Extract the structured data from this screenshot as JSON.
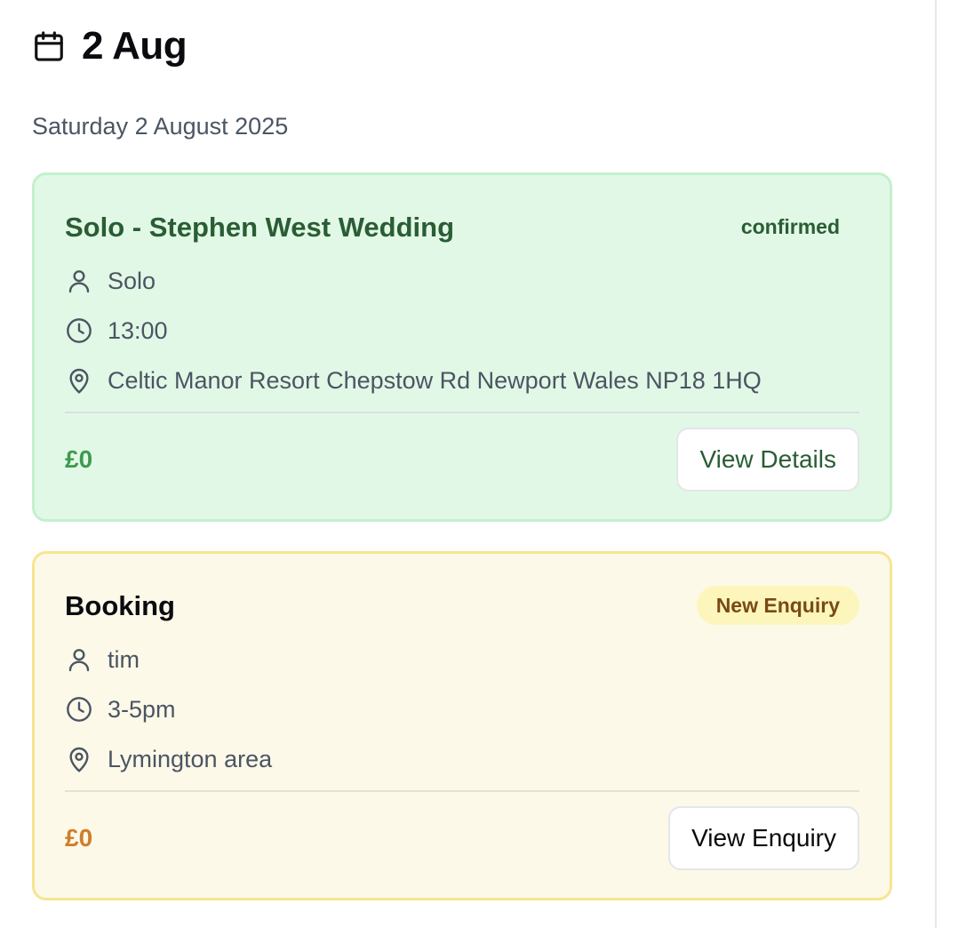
{
  "header": {
    "title": "2 Aug",
    "subtitle": "Saturday 2 August 2025"
  },
  "events": [
    {
      "title": "Solo - Stephen West Wedding",
      "status": "confirmed",
      "performer": "Solo",
      "time": "13:00",
      "location": "Celtic Manor Resort Chepstow Rd Newport Wales NP18 1HQ",
      "price": "£0",
      "action_label": "View Details",
      "accent_color": "#2a5d34",
      "background_color": "#e2f8e6"
    },
    {
      "title": "Booking",
      "status": "New Enquiry",
      "performer": "tim",
      "time": "3-5pm",
      "location": "Lymington area",
      "price": "£0",
      "action_label": "View Enquiry",
      "accent_color": "#cf7e29",
      "background_color": "#fdf9e9"
    }
  ],
  "icons": [
    "calendar-icon",
    "user-icon",
    "clock-icon",
    "map-pin-icon"
  ]
}
